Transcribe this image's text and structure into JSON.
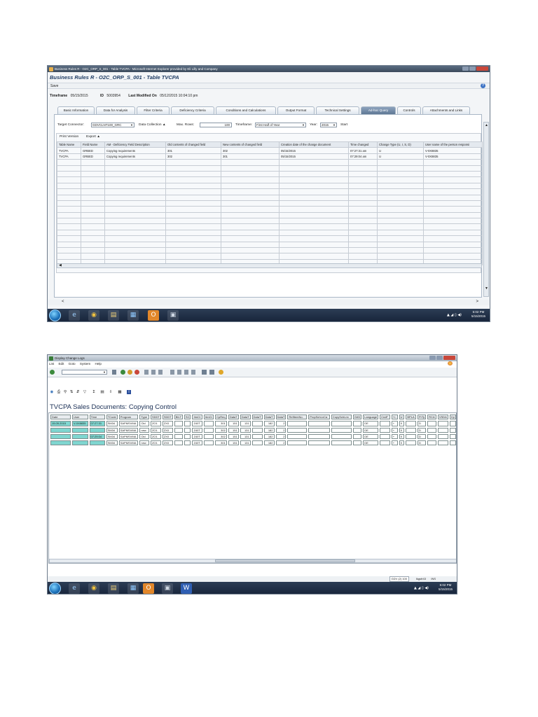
{
  "shot1": {
    "window_title": "Business Rules R - O2C_ORP_S_001 - Table TVCPA - Microsoft Internet Explorer provided by Eli Lilly and Company",
    "header": "Business Rules R - O2C_ORP_S_001 - Table TVCPA",
    "save_label": "Save",
    "help_icon": "help-icon",
    "timeframe_label": "Timeframe",
    "timeframe_value": "05/15/2015",
    "id_label": "ID",
    "id_value": "5003954",
    "lastmod_label": "Last Modified On",
    "lastmod_value": "05/12/2015 10:04:10 pm",
    "tabs": [
      "Basic Information",
      "Data for Analysis",
      "Filter Criteria",
      "Deficiency Criteria",
      "Conditions and Calculations",
      "Output Format",
      "Technical Settings",
      "Ad-hoc Query",
      "Controls",
      "Attachments and Links"
    ],
    "active_tab": 7,
    "target_connector_label": "Target Connector:",
    "target_connector_value": "GDVCLNT100_GRC",
    "data_collection_label": "Data Collection",
    "max_rows_label": "Max. Rows:",
    "max_rows_value": "100",
    "timeframe_sel_label": "Timeframe:",
    "timeframe_sel_value": "First Half of Year",
    "year_label": "Year:",
    "year_value": "2015",
    "start_label": "Start",
    "print_version": "Print Version",
    "export_label": "Export",
    "columns": [
      "Table Name",
      "Field Name",
      "AM - Deficiency Field Description",
      "Old contents of changed field",
      "New contents of changed field",
      "Creation date of the change document",
      "Time changed",
      "Change Type (U, I, S, D)",
      "User name of the person responsi"
    ],
    "rows": [
      [
        "TVCPA",
        "GRBED",
        "Copying requirements",
        "301",
        "302",
        "05/15/2015",
        "07:27:31 am",
        "U",
        "V-0X8835"
      ],
      [
        "TVCPA",
        "GRBED",
        "Copying requirements",
        "302",
        "301",
        "05/15/2015",
        "07:29:04 am",
        "U",
        "V-0X8835"
      ]
    ],
    "clock_time": "5:02 PM",
    "clock_date": "5/15/2015"
  },
  "shot2": {
    "window_title": "Display Change Logs",
    "menu": [
      "List",
      "Edit",
      "Goto",
      "System",
      "Help"
    ],
    "report_title": "TVCPA Sales Documents: Copying Control",
    "columns": [
      "Date",
      "User",
      "Time",
      "TCode",
      "Program",
      "Type",
      "SDDT",
      "SDDT",
      "BILT",
      "SC",
      "ItmCt",
      "ItmCt",
      "CpReq",
      "DataT",
      "DataT",
      "DataT",
      "DataT",
      "DataT",
      "RefItemNo.",
      "PropSchLnCa",
      "CopySchLnn",
      "GrID",
      "Language",
      "CndF",
      "+/-",
      "U",
      "BPLA",
      "PrTy",
      "RCA",
      "VSDA",
      "Cp"
    ],
    "rows": [
      [
        "15.05.2015",
        "V-0X8835",
        "07:27:31",
        "SM34",
        "SAPMSVMA",
        "Old",
        "ZO1",
        "ZX0",
        "",
        "",
        "Z40T",
        "",
        "301",
        "151",
        "131",
        "",
        "182",
        "2",
        "",
        "",
        "",
        "",
        "DE",
        "",
        "+",
        "X",
        "",
        "D",
        "",
        "",
        ""
      ],
      [
        "",
        "",
        "",
        "SM34",
        "SAPMSVMA",
        "new",
        "ZO1",
        "ZX0",
        "",
        "",
        "Z40T",
        "",
        "302",
        "151",
        "131",
        "",
        "182",
        "2",
        "",
        "",
        "",
        "",
        "DE",
        "",
        "+",
        "X",
        "",
        "D",
        "",
        "",
        ""
      ],
      [
        "",
        "",
        "07:29:04",
        "SM34",
        "SAPMSVMA",
        "Old",
        "ZO1",
        "ZX0",
        "",
        "",
        "Z40T",
        "",
        "302",
        "151",
        "131",
        "",
        "182",
        "2",
        "",
        "",
        "",
        "",
        "DE",
        "",
        "+",
        "X",
        "",
        "D",
        "",
        "",
        ""
      ],
      [
        "",
        "",
        "",
        "SM34",
        "SAPMSVMA",
        "new",
        "ZO1",
        "ZX0",
        "",
        "",
        "Z40T",
        "",
        "301",
        "151",
        "131",
        "",
        "182",
        "2",
        "",
        "",
        "",
        "",
        "DE",
        "",
        "+",
        "X",
        "",
        "D",
        "",
        "",
        ""
      ]
    ],
    "status": "GDV (2) 100",
    "status_user": "lkgsfr43",
    "status_mode": "INS",
    "clock_time": "5:02 PM",
    "clock_date": "5/15/2015"
  }
}
